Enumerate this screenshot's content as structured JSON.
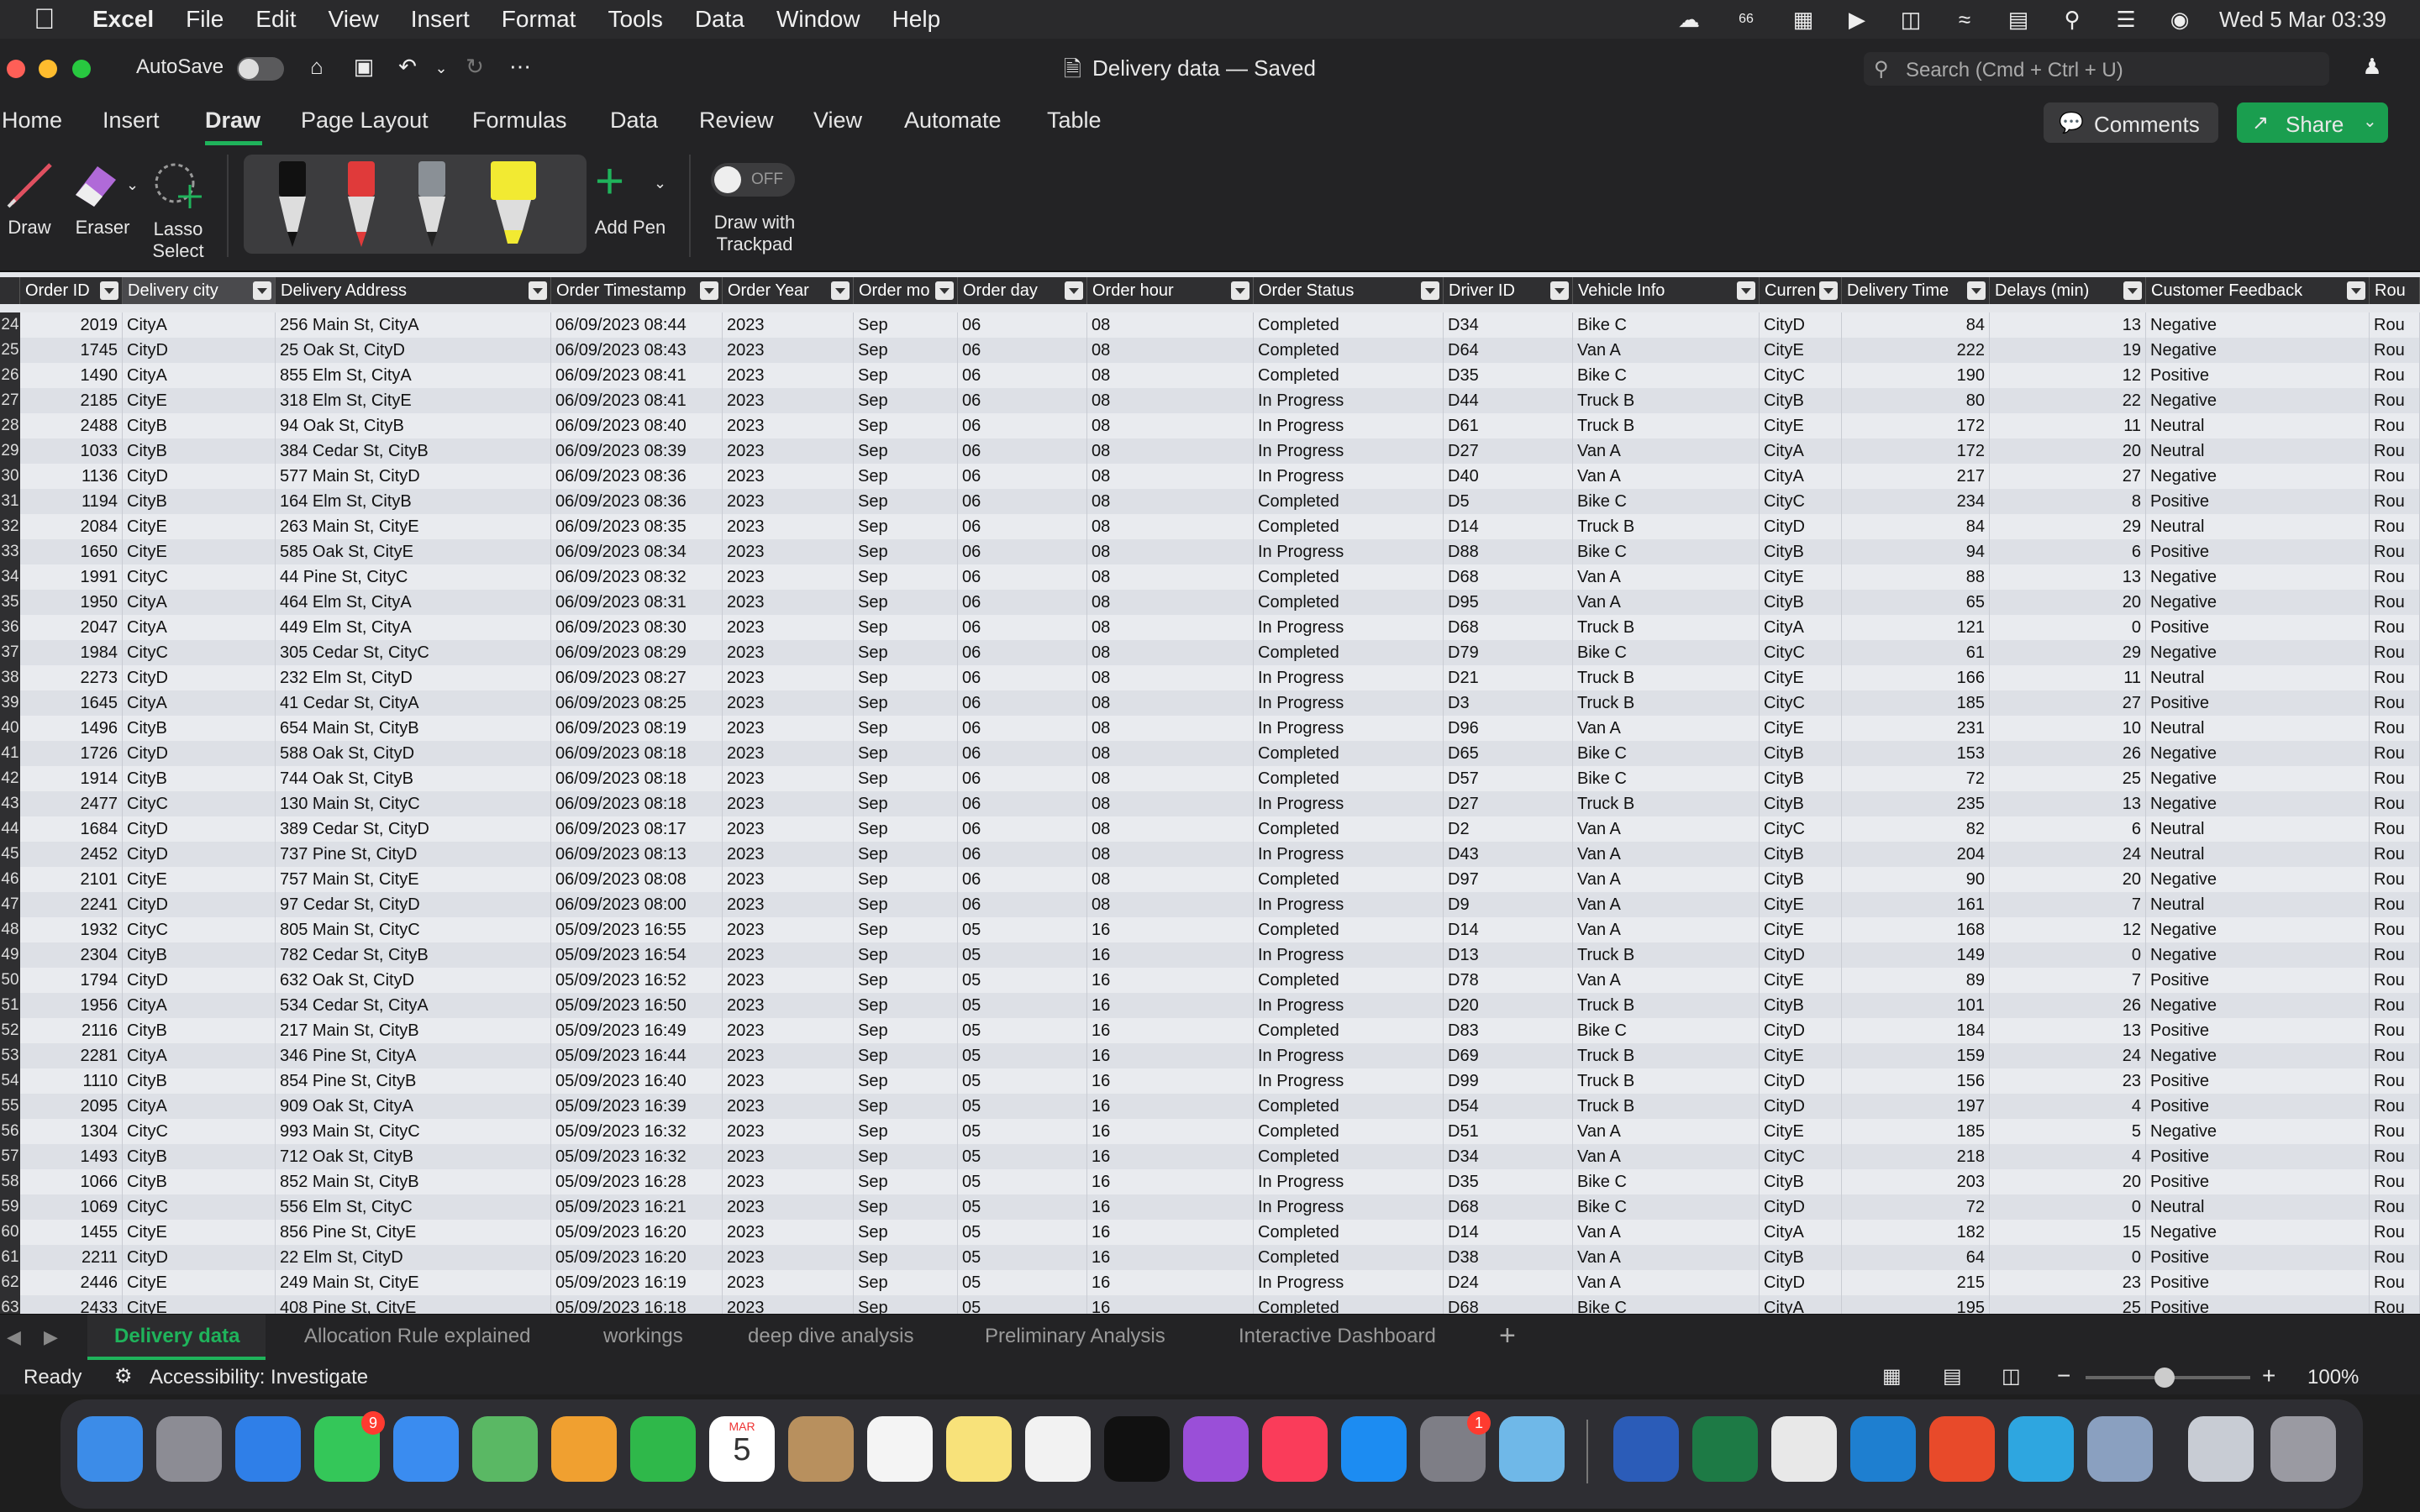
{
  "menubar": {
    "app": "Excel",
    "items": [
      "File",
      "Edit",
      "View",
      "Insert",
      "Format",
      "Tools",
      "Data",
      "Window",
      "Help"
    ],
    "clock": "Wed 5 Mar  03:39",
    "badge": "66"
  },
  "titlebar": {
    "autosave_label": "AutoSave",
    "doc_title": "Delivery data — Saved",
    "search_placeholder": "Search (Cmd + Ctrl + U)"
  },
  "ribbon_tabs": [
    "Home",
    "Insert",
    "Draw",
    "Page Layout",
    "Formulas",
    "Data",
    "Review",
    "View",
    "Automate",
    "Table"
  ],
  "ribbon_tab_active": "Draw",
  "comments_label": "Comments",
  "share_label": "Share",
  "draw_tools": {
    "draw": "Draw",
    "eraser": "Eraser",
    "lasso": "Lasso Select",
    "add_pen": "Add Pen",
    "trackpad": "Draw with Trackpad",
    "toggle": "OFF"
  },
  "columns": [
    "Order ID",
    "Delivery city",
    "Delivery Address",
    "Order Timestamp",
    "Order Year",
    "Order mo",
    "Order day",
    "Order hour",
    "Order Status",
    "Driver ID",
    "Vehicle Info",
    "Curren",
    "Delivery Time",
    "Delays (min)",
    "Customer Feedback",
    "Rou"
  ],
  "rows": [
    [
      "24",
      "2019",
      "CityA",
      "256 Main St, CityA",
      "06/09/2023 08:44",
      "2023",
      "Sep",
      "06",
      "08",
      "Completed",
      "D34",
      "Bike C",
      "CityD",
      "84",
      "13",
      "Negative",
      "Rou"
    ],
    [
      "25",
      "1745",
      "CityD",
      "25 Oak St, CityD",
      "06/09/2023 08:43",
      "2023",
      "Sep",
      "06",
      "08",
      "Completed",
      "D64",
      "Van A",
      "CityE",
      "222",
      "19",
      "Negative",
      "Rou"
    ],
    [
      "26",
      "1490",
      "CityA",
      "855 Elm St, CityA",
      "06/09/2023 08:41",
      "2023",
      "Sep",
      "06",
      "08",
      "Completed",
      "D35",
      "Bike C",
      "CityC",
      "190",
      "12",
      "Positive",
      "Rou"
    ],
    [
      "27",
      "2185",
      "CityE",
      "318 Elm St, CityE",
      "06/09/2023 08:41",
      "2023",
      "Sep",
      "06",
      "08",
      "In Progress",
      "D44",
      "Truck B",
      "CityB",
      "80",
      "22",
      "Negative",
      "Rou"
    ],
    [
      "28",
      "2488",
      "CityB",
      "94 Oak St, CityB",
      "06/09/2023 08:40",
      "2023",
      "Sep",
      "06",
      "08",
      "In Progress",
      "D61",
      "Truck B",
      "CityE",
      "172",
      "11",
      "Neutral",
      "Rou"
    ],
    [
      "29",
      "1033",
      "CityB",
      "384 Cedar St, CityB",
      "06/09/2023 08:39",
      "2023",
      "Sep",
      "06",
      "08",
      "In Progress",
      "D27",
      "Van A",
      "CityA",
      "172",
      "20",
      "Neutral",
      "Rou"
    ],
    [
      "30",
      "1136",
      "CityD",
      "577 Main St, CityD",
      "06/09/2023 08:36",
      "2023",
      "Sep",
      "06",
      "08",
      "In Progress",
      "D40",
      "Van A",
      "CityA",
      "217",
      "27",
      "Negative",
      "Rou"
    ],
    [
      "31",
      "1194",
      "CityB",
      "164 Elm St, CityB",
      "06/09/2023 08:36",
      "2023",
      "Sep",
      "06",
      "08",
      "Completed",
      "D5",
      "Bike C",
      "CityC",
      "234",
      "8",
      "Positive",
      "Rou"
    ],
    [
      "32",
      "2084",
      "CityE",
      "263 Main St, CityE",
      "06/09/2023 08:35",
      "2023",
      "Sep",
      "06",
      "08",
      "Completed",
      "D14",
      "Truck B",
      "CityD",
      "84",
      "29",
      "Neutral",
      "Rou"
    ],
    [
      "33",
      "1650",
      "CityE",
      "585 Oak St, CityE",
      "06/09/2023 08:34",
      "2023",
      "Sep",
      "06",
      "08",
      "In Progress",
      "D88",
      "Bike C",
      "CityB",
      "94",
      "6",
      "Positive",
      "Rou"
    ],
    [
      "34",
      "1991",
      "CityC",
      "44 Pine St, CityC",
      "06/09/2023 08:32",
      "2023",
      "Sep",
      "06",
      "08",
      "Completed",
      "D68",
      "Van A",
      "CityE",
      "88",
      "13",
      "Negative",
      "Rou"
    ],
    [
      "35",
      "1950",
      "CityA",
      "464 Elm St, CityA",
      "06/09/2023 08:31",
      "2023",
      "Sep",
      "06",
      "08",
      "Completed",
      "D95",
      "Van A",
      "CityB",
      "65",
      "20",
      "Negative",
      "Rou"
    ],
    [
      "36",
      "2047",
      "CityA",
      "449 Elm St, CityA",
      "06/09/2023 08:30",
      "2023",
      "Sep",
      "06",
      "08",
      "In Progress",
      "D68",
      "Truck B",
      "CityA",
      "121",
      "0",
      "Positive",
      "Rou"
    ],
    [
      "37",
      "1984",
      "CityC",
      "305 Cedar St, CityC",
      "06/09/2023 08:29",
      "2023",
      "Sep",
      "06",
      "08",
      "Completed",
      "D79",
      "Bike C",
      "CityC",
      "61",
      "29",
      "Negative",
      "Rou"
    ],
    [
      "38",
      "2273",
      "CityD",
      "232 Elm St, CityD",
      "06/09/2023 08:27",
      "2023",
      "Sep",
      "06",
      "08",
      "In Progress",
      "D21",
      "Truck B",
      "CityE",
      "166",
      "11",
      "Neutral",
      "Rou"
    ],
    [
      "39",
      "1645",
      "CityA",
      "41 Cedar St, CityA",
      "06/09/2023 08:25",
      "2023",
      "Sep",
      "06",
      "08",
      "In Progress",
      "D3",
      "Truck B",
      "CityC",
      "185",
      "27",
      "Positive",
      "Rou"
    ],
    [
      "40",
      "1496",
      "CityB",
      "654 Main St, CityB",
      "06/09/2023 08:19",
      "2023",
      "Sep",
      "06",
      "08",
      "In Progress",
      "D96",
      "Van A",
      "CityE",
      "231",
      "10",
      "Neutral",
      "Rou"
    ],
    [
      "41",
      "1726",
      "CityD",
      "588 Oak St, CityD",
      "06/09/2023 08:18",
      "2023",
      "Sep",
      "06",
      "08",
      "Completed",
      "D65",
      "Bike C",
      "CityB",
      "153",
      "26",
      "Negative",
      "Rou"
    ],
    [
      "42",
      "1914",
      "CityB",
      "744 Oak St, CityB",
      "06/09/2023 08:18",
      "2023",
      "Sep",
      "06",
      "08",
      "Completed",
      "D57",
      "Bike C",
      "CityB",
      "72",
      "25",
      "Negative",
      "Rou"
    ],
    [
      "43",
      "2477",
      "CityC",
      "130 Main St, CityC",
      "06/09/2023 08:18",
      "2023",
      "Sep",
      "06",
      "08",
      "In Progress",
      "D27",
      "Truck B",
      "CityB",
      "235",
      "13",
      "Negative",
      "Rou"
    ],
    [
      "44",
      "1684",
      "CityD",
      "389 Cedar St, CityD",
      "06/09/2023 08:17",
      "2023",
      "Sep",
      "06",
      "08",
      "Completed",
      "D2",
      "Van A",
      "CityC",
      "82",
      "6",
      "Neutral",
      "Rou"
    ],
    [
      "45",
      "2452",
      "CityD",
      "737 Pine St, CityD",
      "06/09/2023 08:13",
      "2023",
      "Sep",
      "06",
      "08",
      "In Progress",
      "D43",
      "Van A",
      "CityB",
      "204",
      "24",
      "Neutral",
      "Rou"
    ],
    [
      "46",
      "2101",
      "CityE",
      "757 Main St, CityE",
      "06/09/2023 08:08",
      "2023",
      "Sep",
      "06",
      "08",
      "Completed",
      "D97",
      "Van A",
      "CityB",
      "90",
      "20",
      "Negative",
      "Rou"
    ],
    [
      "47",
      "2241",
      "CityD",
      "97 Cedar St, CityD",
      "06/09/2023 08:00",
      "2023",
      "Sep",
      "06",
      "08",
      "In Progress",
      "D9",
      "Van A",
      "CityE",
      "161",
      "7",
      "Neutral",
      "Rou"
    ],
    [
      "48",
      "1932",
      "CityC",
      "805 Main St, CityC",
      "05/09/2023 16:55",
      "2023",
      "Sep",
      "05",
      "16",
      "Completed",
      "D14",
      "Van A",
      "CityE",
      "168",
      "12",
      "Negative",
      "Rou"
    ],
    [
      "49",
      "2304",
      "CityB",
      "782 Cedar St, CityB",
      "05/09/2023 16:54",
      "2023",
      "Sep",
      "05",
      "16",
      "In Progress",
      "D13",
      "Truck B",
      "CityD",
      "149",
      "0",
      "Negative",
      "Rou"
    ],
    [
      "50",
      "1794",
      "CityD",
      "632 Oak St, CityD",
      "05/09/2023 16:52",
      "2023",
      "Sep",
      "05",
      "16",
      "Completed",
      "D78",
      "Van A",
      "CityE",
      "89",
      "7",
      "Positive",
      "Rou"
    ],
    [
      "51",
      "1956",
      "CityA",
      "534 Cedar St, CityA",
      "05/09/2023 16:50",
      "2023",
      "Sep",
      "05",
      "16",
      "In Progress",
      "D20",
      "Truck B",
      "CityB",
      "101",
      "26",
      "Negative",
      "Rou"
    ],
    [
      "52",
      "2116",
      "CityB",
      "217 Main St, CityB",
      "05/09/2023 16:49",
      "2023",
      "Sep",
      "05",
      "16",
      "Completed",
      "D83",
      "Bike C",
      "CityD",
      "184",
      "13",
      "Positive",
      "Rou"
    ],
    [
      "53",
      "2281",
      "CityA",
      "346 Pine St, CityA",
      "05/09/2023 16:44",
      "2023",
      "Sep",
      "05",
      "16",
      "In Progress",
      "D69",
      "Truck B",
      "CityE",
      "159",
      "24",
      "Negative",
      "Rou"
    ],
    [
      "54",
      "1110",
      "CityB",
      "854 Pine St, CityB",
      "05/09/2023 16:40",
      "2023",
      "Sep",
      "05",
      "16",
      "In Progress",
      "D99",
      "Truck B",
      "CityD",
      "156",
      "23",
      "Positive",
      "Rou"
    ],
    [
      "55",
      "2095",
      "CityA",
      "909 Oak St, CityA",
      "05/09/2023 16:39",
      "2023",
      "Sep",
      "05",
      "16",
      "Completed",
      "D54",
      "Truck B",
      "CityD",
      "197",
      "4",
      "Positive",
      "Rou"
    ],
    [
      "56",
      "1304",
      "CityC",
      "993 Main St, CityC",
      "05/09/2023 16:32",
      "2023",
      "Sep",
      "05",
      "16",
      "Completed",
      "D51",
      "Van A",
      "CityE",
      "185",
      "5",
      "Negative",
      "Rou"
    ],
    [
      "57",
      "1493",
      "CityB",
      "712 Oak St, CityB",
      "05/09/2023 16:32",
      "2023",
      "Sep",
      "05",
      "16",
      "Completed",
      "D34",
      "Van A",
      "CityC",
      "218",
      "4",
      "Positive",
      "Rou"
    ],
    [
      "58",
      "1066",
      "CityB",
      "852 Main St, CityB",
      "05/09/2023 16:28",
      "2023",
      "Sep",
      "05",
      "16",
      "In Progress",
      "D35",
      "Bike C",
      "CityB",
      "203",
      "20",
      "Positive",
      "Rou"
    ],
    [
      "59",
      "1069",
      "CityC",
      "556 Elm St, CityC",
      "05/09/2023 16:21",
      "2023",
      "Sep",
      "05",
      "16",
      "In Progress",
      "D68",
      "Bike C",
      "CityD",
      "72",
      "0",
      "Neutral",
      "Rou"
    ],
    [
      "60",
      "1455",
      "CityE",
      "856 Pine St, CityE",
      "05/09/2023 16:20",
      "2023",
      "Sep",
      "05",
      "16",
      "Completed",
      "D14",
      "Van A",
      "CityA",
      "182",
      "15",
      "Negative",
      "Rou"
    ],
    [
      "61",
      "2211",
      "CityD",
      "22 Elm St, CityD",
      "05/09/2023 16:20",
      "2023",
      "Sep",
      "05",
      "16",
      "Completed",
      "D38",
      "Van A",
      "CityB",
      "64",
      "0",
      "Positive",
      "Rou"
    ],
    [
      "62",
      "2446",
      "CityE",
      "249 Main St, CityE",
      "05/09/2023 16:19",
      "2023",
      "Sep",
      "05",
      "16",
      "In Progress",
      "D24",
      "Van A",
      "CityD",
      "215",
      "23",
      "Positive",
      "Rou"
    ],
    [
      "63",
      "2433",
      "CityE",
      "408 Pine St, CityE",
      "05/09/2023 16:18",
      "2023",
      "Sep",
      "05",
      "16",
      "Completed",
      "D68",
      "Bike C",
      "CityA",
      "195",
      "25",
      "Positive",
      "Rou"
    ]
  ],
  "sheet_tabs": [
    "Delivery data",
    "Allocation Rule explained",
    "workings",
    "deep dive analysis",
    "Preliminary Analysis",
    "Interactive Dashboard"
  ],
  "status": {
    "ready": "Ready",
    "accessibility": "Accessibility: Investigate",
    "zoom": "100%"
  },
  "dock": {
    "messages_badge": "9",
    "settings_badge": "1",
    "calendar_month": "MAR",
    "calendar_day": "5"
  }
}
